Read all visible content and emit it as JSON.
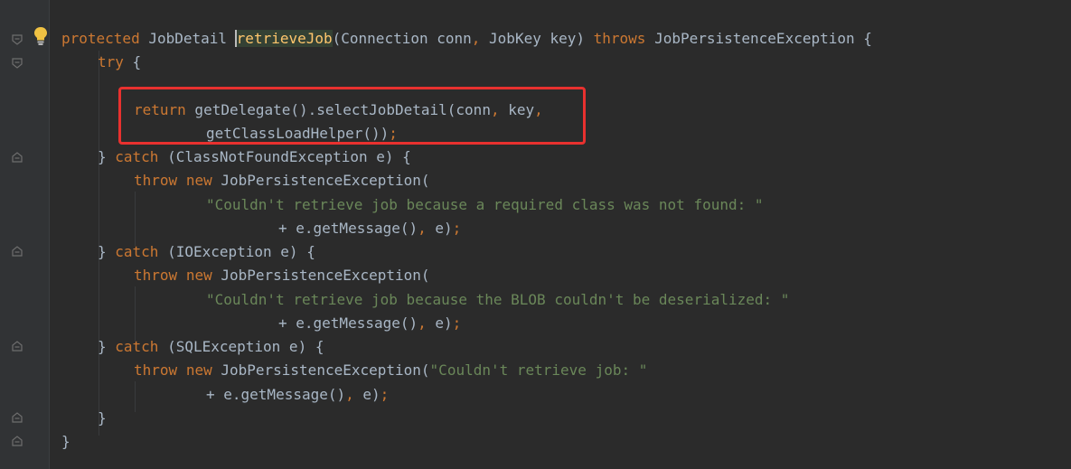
{
  "editor": {
    "lines": [
      {
        "a": "protected",
        "b": " JobDetail ",
        "c": "retrieveJob",
        "d": "(Connection conn",
        "e": ",",
        "f": " JobKey key) ",
        "g": "throws",
        "h": " JobPersistenceException {"
      },
      {
        "a": "try",
        "b": " {"
      },
      {
        "a": ""
      },
      {
        "a": "return",
        "b": " getDelegate().selectJobDetail(conn",
        "c": ",",
        "d": " key",
        "e": ","
      },
      {
        "a": "getClassLoadHelper())",
        "b": ";"
      },
      {
        "a": "} ",
        "b": "catch",
        "c": " (ClassNotFoundException e) {"
      },
      {
        "a": "throw",
        "b": " ",
        "c": "new",
        "d": " JobPersistenceException("
      },
      {
        "a": "\"Couldn't retrieve job because a required class was not found: \""
      },
      {
        "a": "+ e.getMessage()",
        "b": ",",
        "c": " e)",
        "d": ";"
      },
      {
        "a": "} ",
        "b": "catch",
        "c": " (IOException e) {"
      },
      {
        "a": "throw",
        "b": " ",
        "c": "new",
        "d": " JobPersistenceException("
      },
      {
        "a": "\"Couldn't retrieve job because the BLOB couldn't be deserialized: \""
      },
      {
        "a": "+ e.getMessage()",
        "b": ",",
        "c": " e)",
        "d": ";"
      },
      {
        "a": "} ",
        "b": "catch",
        "c": " (SQLException e) {"
      },
      {
        "a": "throw",
        "b": " ",
        "c": "new",
        "d": " JobPersistenceException(",
        "e": "\"Couldn't retrieve job: \""
      },
      {
        "a": "+ e.getMessage()",
        "b": ",",
        "c": " e)",
        "d": ";"
      },
      {
        "a": "}"
      },
      {
        "a": "}"
      }
    ]
  },
  "colors": {
    "background": "#2b2b2b",
    "keyword": "#cc7832",
    "method": "#ffc66d",
    "string": "#6a8759",
    "plain": "#a9b7c6",
    "annotation_box": "#e8312f"
  },
  "icons": {
    "intention": "lightbulb-icon",
    "fold": "fold-marker-icon"
  }
}
